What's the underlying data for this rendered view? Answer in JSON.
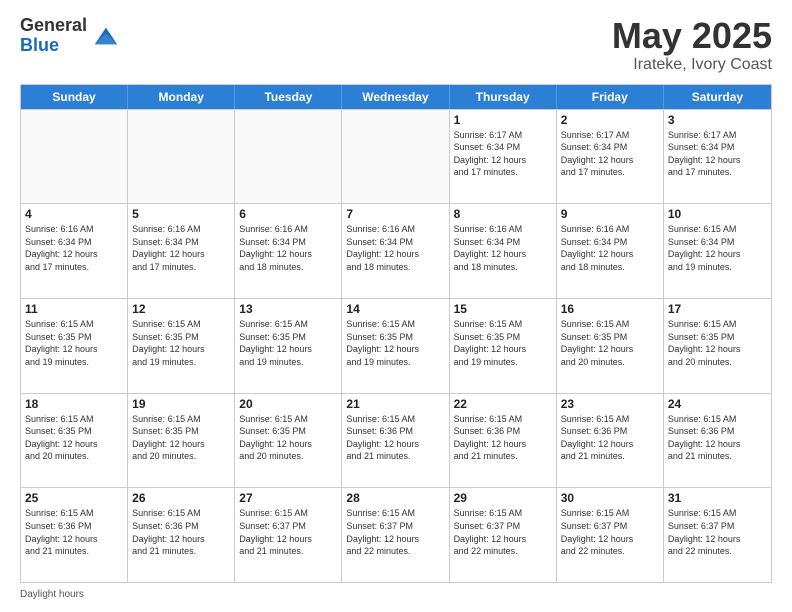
{
  "logo": {
    "general": "General",
    "blue": "Blue"
  },
  "title": "May 2025",
  "location": "Irateke, Ivory Coast",
  "days_of_week": [
    "Sunday",
    "Monday",
    "Tuesday",
    "Wednesday",
    "Thursday",
    "Friday",
    "Saturday"
  ],
  "footer_text": "Daylight hours",
  "weeks": [
    [
      {
        "day": "",
        "detail": "",
        "empty": true
      },
      {
        "day": "",
        "detail": "",
        "empty": true
      },
      {
        "day": "",
        "detail": "",
        "empty": true
      },
      {
        "day": "",
        "detail": "",
        "empty": true
      },
      {
        "day": "1",
        "detail": "Sunrise: 6:17 AM\nSunset: 6:34 PM\nDaylight: 12 hours\nand 17 minutes."
      },
      {
        "day": "2",
        "detail": "Sunrise: 6:17 AM\nSunset: 6:34 PM\nDaylight: 12 hours\nand 17 minutes."
      },
      {
        "day": "3",
        "detail": "Sunrise: 6:17 AM\nSunset: 6:34 PM\nDaylight: 12 hours\nand 17 minutes."
      }
    ],
    [
      {
        "day": "4",
        "detail": "Sunrise: 6:16 AM\nSunset: 6:34 PM\nDaylight: 12 hours\nand 17 minutes."
      },
      {
        "day": "5",
        "detail": "Sunrise: 6:16 AM\nSunset: 6:34 PM\nDaylight: 12 hours\nand 17 minutes."
      },
      {
        "day": "6",
        "detail": "Sunrise: 6:16 AM\nSunset: 6:34 PM\nDaylight: 12 hours\nand 18 minutes."
      },
      {
        "day": "7",
        "detail": "Sunrise: 6:16 AM\nSunset: 6:34 PM\nDaylight: 12 hours\nand 18 minutes."
      },
      {
        "day": "8",
        "detail": "Sunrise: 6:16 AM\nSunset: 6:34 PM\nDaylight: 12 hours\nand 18 minutes."
      },
      {
        "day": "9",
        "detail": "Sunrise: 6:16 AM\nSunset: 6:34 PM\nDaylight: 12 hours\nand 18 minutes."
      },
      {
        "day": "10",
        "detail": "Sunrise: 6:15 AM\nSunset: 6:34 PM\nDaylight: 12 hours\nand 19 minutes."
      }
    ],
    [
      {
        "day": "11",
        "detail": "Sunrise: 6:15 AM\nSunset: 6:35 PM\nDaylight: 12 hours\nand 19 minutes."
      },
      {
        "day": "12",
        "detail": "Sunrise: 6:15 AM\nSunset: 6:35 PM\nDaylight: 12 hours\nand 19 minutes."
      },
      {
        "day": "13",
        "detail": "Sunrise: 6:15 AM\nSunset: 6:35 PM\nDaylight: 12 hours\nand 19 minutes."
      },
      {
        "day": "14",
        "detail": "Sunrise: 6:15 AM\nSunset: 6:35 PM\nDaylight: 12 hours\nand 19 minutes."
      },
      {
        "day": "15",
        "detail": "Sunrise: 6:15 AM\nSunset: 6:35 PM\nDaylight: 12 hours\nand 19 minutes."
      },
      {
        "day": "16",
        "detail": "Sunrise: 6:15 AM\nSunset: 6:35 PM\nDaylight: 12 hours\nand 20 minutes."
      },
      {
        "day": "17",
        "detail": "Sunrise: 6:15 AM\nSunset: 6:35 PM\nDaylight: 12 hours\nand 20 minutes."
      }
    ],
    [
      {
        "day": "18",
        "detail": "Sunrise: 6:15 AM\nSunset: 6:35 PM\nDaylight: 12 hours\nand 20 minutes."
      },
      {
        "day": "19",
        "detail": "Sunrise: 6:15 AM\nSunset: 6:35 PM\nDaylight: 12 hours\nand 20 minutes."
      },
      {
        "day": "20",
        "detail": "Sunrise: 6:15 AM\nSunset: 6:35 PM\nDaylight: 12 hours\nand 20 minutes."
      },
      {
        "day": "21",
        "detail": "Sunrise: 6:15 AM\nSunset: 6:36 PM\nDaylight: 12 hours\nand 21 minutes."
      },
      {
        "day": "22",
        "detail": "Sunrise: 6:15 AM\nSunset: 6:36 PM\nDaylight: 12 hours\nand 21 minutes."
      },
      {
        "day": "23",
        "detail": "Sunrise: 6:15 AM\nSunset: 6:36 PM\nDaylight: 12 hours\nand 21 minutes."
      },
      {
        "day": "24",
        "detail": "Sunrise: 6:15 AM\nSunset: 6:36 PM\nDaylight: 12 hours\nand 21 minutes."
      }
    ],
    [
      {
        "day": "25",
        "detail": "Sunrise: 6:15 AM\nSunset: 6:36 PM\nDaylight: 12 hours\nand 21 minutes."
      },
      {
        "day": "26",
        "detail": "Sunrise: 6:15 AM\nSunset: 6:36 PM\nDaylight: 12 hours\nand 21 minutes."
      },
      {
        "day": "27",
        "detail": "Sunrise: 6:15 AM\nSunset: 6:37 PM\nDaylight: 12 hours\nand 21 minutes."
      },
      {
        "day": "28",
        "detail": "Sunrise: 6:15 AM\nSunset: 6:37 PM\nDaylight: 12 hours\nand 22 minutes."
      },
      {
        "day": "29",
        "detail": "Sunrise: 6:15 AM\nSunset: 6:37 PM\nDaylight: 12 hours\nand 22 minutes."
      },
      {
        "day": "30",
        "detail": "Sunrise: 6:15 AM\nSunset: 6:37 PM\nDaylight: 12 hours\nand 22 minutes."
      },
      {
        "day": "31",
        "detail": "Sunrise: 6:15 AM\nSunset: 6:37 PM\nDaylight: 12 hours\nand 22 minutes."
      }
    ]
  ]
}
